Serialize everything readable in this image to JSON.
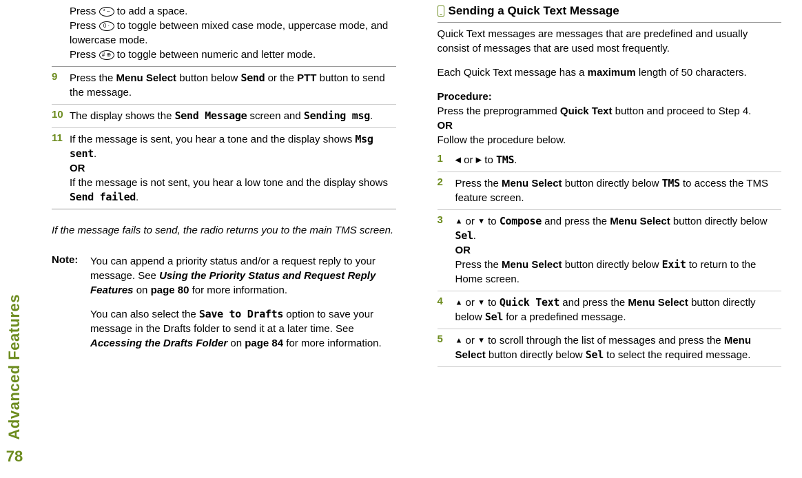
{
  "sidebar": {
    "label": "Advanced Features",
    "page": "78"
  },
  "left": {
    "intro": {
      "line1_a": "Press ",
      "key1": "* –",
      "line1_b": " to add a space.",
      "line2_a": "Press ",
      "key2": "0 ·",
      "line2_b": " to toggle between mixed case mode, uppercase mode, and lowercase mode.",
      "line3_a": "Press ",
      "key3": "# ⊕",
      "line3_b": " to toggle between numeric and letter mode."
    },
    "step9": {
      "num": "9",
      "a": "Press the ",
      "b": "Menu Select",
      "c": " button below ",
      "d": "Send",
      "e": " or the ",
      "f": "PTT",
      "g": " button to send the message."
    },
    "step10": {
      "num": "10",
      "a": "The display shows the ",
      "b": "Send Message",
      "c": " screen and ",
      "d": "Sending msg",
      "e": "."
    },
    "step11": {
      "num": "11",
      "a": "If the message is sent, you hear a tone and the display shows ",
      "b": "Msg sent",
      "c": ".",
      "or": "OR",
      "d": "If the message is not sent, you hear a low tone and the display shows ",
      "e": "Send failed",
      "f": "."
    },
    "fail_note": "If the message fails to send, the radio returns you to the main TMS screen.",
    "note": {
      "label": "Note:",
      "p1_a": "You can append a priority status and/or a request reply to your message. See ",
      "p1_b": "Using the Priority Status and Request Reply Features",
      "p1_c": " on ",
      "p1_d": "page 80",
      "p1_e": " for more information.",
      "p2_a": "You can also select the ",
      "p2_b": "Save to Drafts",
      "p2_c": " option to save your message in the Drafts folder to send it at a later time. See ",
      "p2_d": "Accessing the Drafts Folder",
      "p2_e": " on ",
      "p2_f": "page 84",
      "p2_g": " for more information."
    }
  },
  "right": {
    "header": "Sending a Quick Text Message",
    "intro1": "Quick Text messages are messages that are predefined and usually consist of messages that are used most frequently.",
    "intro2_a": "Each Quick Text message has a ",
    "intro2_b": "maximum",
    "intro2_c": " length of 50 characters.",
    "proc_label": "Procedure:",
    "proc_a": "Press the preprogrammed ",
    "proc_b": "Quick Text",
    "proc_c": " button and proceed to Step 4.",
    "or": "OR",
    "proc_d": "Follow the procedure below.",
    "step1": {
      "num": "1",
      "a": " or ",
      "b": " to ",
      "c": "TMS",
      "d": "."
    },
    "step2": {
      "num": "2",
      "a": "Press the ",
      "b": "Menu Select",
      "c": " button directly below ",
      "d": "TMS",
      "e": " to access the TMS feature screen."
    },
    "step3": {
      "num": "3",
      "a": " or ",
      "b": " to ",
      "c": "Compose",
      "d": " and press the ",
      "e": "Menu Select",
      "f": " button directly below ",
      "g": "Sel",
      "h": ".",
      "or": "OR",
      "i": "Press the ",
      "j": "Menu Select",
      "k": " button directly below ",
      "l": "Exit",
      "m": " to return to the Home screen."
    },
    "step4": {
      "num": "4",
      "a": " or ",
      "b": " to ",
      "c": "Quick Text",
      "d": " and press the ",
      "e": "Menu Select",
      "f": " button directly below ",
      "g": "Sel",
      "h": " for a predefined message."
    },
    "step5": {
      "num": "5",
      "a": " or ",
      "b": " to scroll through the list of messages and press the ",
      "c": "Menu Select",
      "d": " button directly below ",
      "e": "Sel",
      "f": " to select the required message."
    }
  }
}
